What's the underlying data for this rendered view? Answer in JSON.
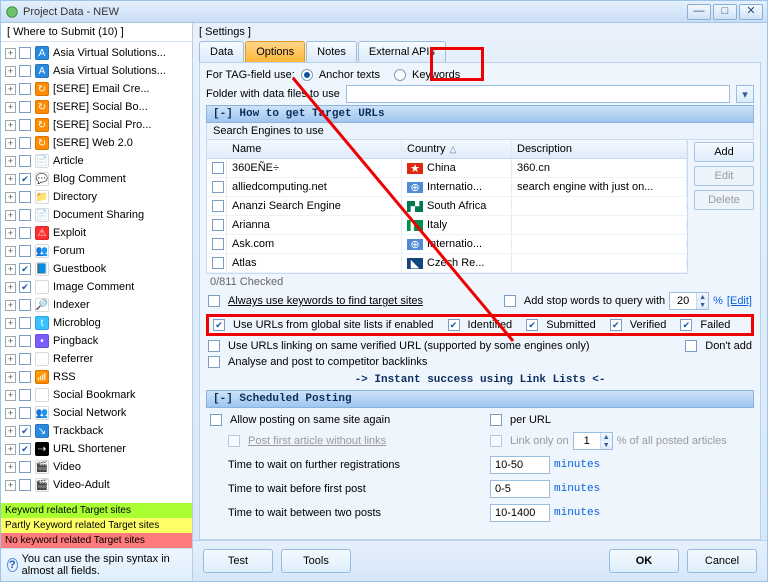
{
  "window": {
    "title": "Project Data - NEW"
  },
  "sidebar": {
    "header": "[ Where to Submit  (10) ]",
    "items": [
      {
        "label": "Asia Virtual Solutions...",
        "checked": false,
        "iconbg": "#2a8adf",
        "glyph": "A"
      },
      {
        "label": "Asia Virtual Solutions...",
        "checked": false,
        "iconbg": "#2a8adf",
        "glyph": "A"
      },
      {
        "label": "[SERE] Email Cre...",
        "checked": false,
        "iconbg": "#ff8b00",
        "glyph": "↻"
      },
      {
        "label": "[SERE] Social Bo...",
        "checked": false,
        "iconbg": "#ff8b00",
        "glyph": "↻"
      },
      {
        "label": "[SERE] Social Pro...",
        "checked": false,
        "iconbg": "#ff8b00",
        "glyph": "↻"
      },
      {
        "label": "[SERE] Web 2.0",
        "checked": false,
        "iconbg": "#ff8b00",
        "glyph": "↻"
      },
      {
        "label": "Article",
        "checked": false,
        "iconbg": "#ffffff",
        "glyph": "📄"
      },
      {
        "label": "Blog Comment",
        "checked": true,
        "iconbg": "#ffffff",
        "glyph": "💬"
      },
      {
        "label": "Directory",
        "checked": false,
        "iconbg": "#ffffff",
        "glyph": "📁"
      },
      {
        "label": "Document Sharing",
        "checked": false,
        "iconbg": "#ffffff",
        "glyph": "📄"
      },
      {
        "label": "Exploit",
        "checked": false,
        "iconbg": "#ff2d2d",
        "glyph": "⚠"
      },
      {
        "label": "Forum",
        "checked": false,
        "iconbg": "#ffffff",
        "glyph": "👥"
      },
      {
        "label": "Guestbook",
        "checked": true,
        "iconbg": "#ffffff",
        "glyph": "📘"
      },
      {
        "label": "Image Comment",
        "checked": true,
        "iconbg": "#ffffff",
        "glyph": "🖼"
      },
      {
        "label": "Indexer",
        "checked": false,
        "iconbg": "#ffffff",
        "glyph": "🔎"
      },
      {
        "label": "Microblog",
        "checked": false,
        "iconbg": "#37c3ff",
        "glyph": "t"
      },
      {
        "label": "Pingback",
        "checked": false,
        "iconbg": "#7a5cff",
        "glyph": "•"
      },
      {
        "label": "Referrer",
        "checked": false,
        "iconbg": "#ffffff",
        "glyph": "↩"
      },
      {
        "label": "RSS",
        "checked": false,
        "iconbg": "#ff8b00",
        "glyph": "📶"
      },
      {
        "label": "Social Bookmark",
        "checked": false,
        "iconbg": "#ffffff",
        "glyph": "★"
      },
      {
        "label": "Social Network",
        "checked": false,
        "iconbg": "#ffffff",
        "glyph": "👥"
      },
      {
        "label": "Trackback",
        "checked": true,
        "iconbg": "#2a8adf",
        "glyph": "↘"
      },
      {
        "label": "URL Shortener",
        "checked": true,
        "iconbg": "#000000",
        "glyph": "⇢"
      },
      {
        "label": "Video",
        "checked": false,
        "iconbg": "#ffffff",
        "glyph": "🎬"
      },
      {
        "label": "Video-Adult",
        "checked": false,
        "iconbg": "#ffffff",
        "glyph": "🎬"
      }
    ],
    "legend": {
      "l1": "Keyword related Target sites",
      "l2": "Partly Keyword related Target sites",
      "l3": "No keyword related Target sites"
    },
    "tip": "You can use the spin syntax in almost all fields."
  },
  "tabs": {
    "t0": "Data",
    "t1": "Options",
    "t2": "Notes",
    "t3": "External APIs"
  },
  "settings_label": "[ Settings ]",
  "top": {
    "for_tags": "For TAG-field use:",
    "r_anchor": "Anchor texts",
    "r_keywords": "Keywords",
    "folder_label": "Folder with data files to use"
  },
  "section1": {
    "hdr": "[-] How to get Target URLs",
    "sub": "Search Engines to use",
    "cols": {
      "name": "Name",
      "country": "Country",
      "desc": "Description"
    },
    "rows": [
      {
        "name": "360EÑE÷",
        "country": "China",
        "desc": "360.cn",
        "flag": "cn"
      },
      {
        "name": "alliedcomputing.net",
        "country": "Internatio...",
        "desc": "search engine with just on...",
        "flag": "intl"
      },
      {
        "name": "Ananzi Search Engine",
        "country": "South Africa",
        "desc": "",
        "flag": "za"
      },
      {
        "name": "Arianna",
        "country": "Italy",
        "desc": "",
        "flag": "it"
      },
      {
        "name": "Ask.com",
        "country": "Internatio...",
        "desc": "",
        "flag": "intl"
      },
      {
        "name": "Atlas",
        "country": "Czech Re...",
        "desc": "",
        "flag": "cz"
      }
    ],
    "btn_add": "Add",
    "btn_edit": "Edit",
    "btn_delete": "Delete",
    "checked_count": "0/811 Checked",
    "always_kw": "Always use keywords to find target sites",
    "add_stop": "Add stop words to query with",
    "stop_value": "20",
    "stop_pct": "%",
    "edit": "[Edit]",
    "global": "Use URLs from global site lists if enabled",
    "g_identified": "Identified",
    "g_submitted": "Submitted",
    "g_verified": "Verified",
    "g_failed": "Failed",
    "same_verified": "Use URLs linking on same verified URL (supported by some engines only)",
    "dont_add": "Don't add",
    "analyse": "Analyse and post to competitor backlinks",
    "instant": "-> Instant success using Link Lists <-"
  },
  "section2": {
    "hdr": "[-] Scheduled Posting",
    "allow": "Allow posting on same site again",
    "per_url": "per URL",
    "post_first": "Post first article without links",
    "link_only": "Link only on",
    "link_value": "1",
    "pct_label": "% of all posted articles",
    "wait_reg": "Time to wait on further registrations",
    "wait_reg_v": "10-50",
    "wait_first": "Time to wait before first post",
    "wait_first_v": "0-5",
    "wait_two": "Time to wait between two posts",
    "wait_two_v": "10-1400",
    "minutes": "minutes"
  },
  "buttons": {
    "test": "Test",
    "tools": "Tools",
    "ok": "OK",
    "cancel": "Cancel"
  }
}
